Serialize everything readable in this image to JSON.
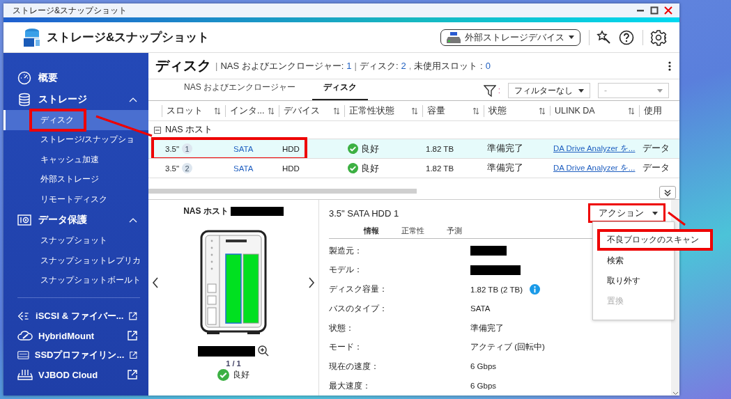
{
  "window": {
    "title": "ストレージ&スナップショット"
  },
  "header": {
    "app_title": "ストレージ&スナップショット",
    "device_menu": "外部ストレージデバイス"
  },
  "sidebar": {
    "items": [
      {
        "label": "概要",
        "kind": "gauge"
      },
      {
        "label": "ストレージ",
        "kind": "database",
        "expanded": true,
        "children": [
          {
            "label": "ディスク",
            "selected": true,
            "highlighted": true
          },
          {
            "label": "ストレージ/スナップショ",
            "selected": false,
            "highlighted": false
          },
          {
            "label": "キャッシュ加速",
            "selected": false,
            "highlighted": false
          },
          {
            "label": "外部ストレージ",
            "selected": false,
            "highlighted": false
          },
          {
            "label": "リモートディスク",
            "selected": false,
            "highlighted": false
          }
        ]
      },
      {
        "label": "データ保護",
        "kind": "camera",
        "expanded": true,
        "children": [
          {
            "label": "スナップショット",
            "selected": false,
            "highlighted": false
          },
          {
            "label": "スナップショットレプリカ",
            "selected": false,
            "highlighted": false
          },
          {
            "label": "スナップショットボールト",
            "selected": false,
            "highlighted": false
          }
        ]
      }
    ],
    "links": [
      {
        "label": "iSCSI & ファイバー...",
        "kind": "iscsi"
      },
      {
        "label": "HybridMount",
        "kind": "cloud"
      },
      {
        "label": "SSDプロファイリン...",
        "kind": "ssd"
      },
      {
        "label": "VJBOD Cloud",
        "kind": "vjbod"
      }
    ]
  },
  "page": {
    "title": "ディスク",
    "summary": [
      {
        "separator": "|",
        "label": "NAS およびエンクロージャー:",
        "value": "1"
      },
      {
        "separator": "|",
        "label": "ディスク:",
        "value": "2"
      },
      {
        "separator": ",",
        "label": "未使用スロット :",
        "value": "0"
      }
    ]
  },
  "tabs": [
    {
      "label": "NAS およびエンクロージャー",
      "selected": false
    },
    {
      "label": "ディスク",
      "selected": true
    }
  ],
  "filter": {
    "separator": ":",
    "value": "フィルターなし",
    "second": "-"
  },
  "table": {
    "columns": [
      "スロット",
      "インタ...",
      "デバイス",
      "正常性状態",
      "容量",
      "状態",
      "ULINK DA",
      "使用"
    ],
    "group": {
      "label": "NAS ホスト",
      "expanded": true
    },
    "rows": [
      {
        "slot": "3.5\"",
        "slot_number": "1",
        "interface": "SATA",
        "device": "HDD",
        "health": "良好",
        "capacity": "1.82 TB",
        "status": "準備完了",
        "ulink": "DA Drive Analyzer を...",
        "usage": "データ",
        "selected": true,
        "highlighted": true
      },
      {
        "slot": "3.5\"",
        "slot_number": "2",
        "interface": "SATA",
        "device": "HDD",
        "health": "良好",
        "capacity": "1.82 TB",
        "status": "準備完了",
        "ulink": "DA Drive Analyzer を...",
        "usage": "データ",
        "selected": false,
        "highlighted": false
      }
    ]
  },
  "enclosure": {
    "title": "NAS ホスト",
    "title_redacted": true,
    "name_redacted": true,
    "page": "1 / 1",
    "status": "良好"
  },
  "detail": {
    "title": "3.5\" SATA HDD 1",
    "action": "アクション",
    "action_highlighted": true,
    "tabs": [
      {
        "label": "情報",
        "selected": true
      },
      {
        "label": "正常性",
        "selected": false
      },
      {
        "label": "予測",
        "selected": false
      }
    ],
    "fields": [
      {
        "label": "製造元：",
        "redacted": true
      },
      {
        "label": "モデル：",
        "redacted": true
      },
      {
        "label": "ディスク容量：",
        "value": "1.82 TB (2 TB)",
        "info": true
      },
      {
        "label": "バスのタイプ：",
        "value": "SATA"
      },
      {
        "label": "状態：",
        "value": "準備完了"
      },
      {
        "label": "モード：",
        "value": "アクティブ (回転中)"
      },
      {
        "label": "現在の速度：",
        "value": "6 Gbps"
      },
      {
        "label": "最大速度：",
        "value": "6 Gbps"
      }
    ]
  },
  "action_menu": [
    {
      "label": "不良ブロックのスキャン",
      "disabled": false,
      "highlighted": true
    },
    {
      "label": "検索",
      "disabled": false,
      "highlighted": false
    },
    {
      "label": "取り外す",
      "disabled": false,
      "highlighted": false
    },
    {
      "label": "置換",
      "disabled": true,
      "highlighted": false
    }
  ]
}
